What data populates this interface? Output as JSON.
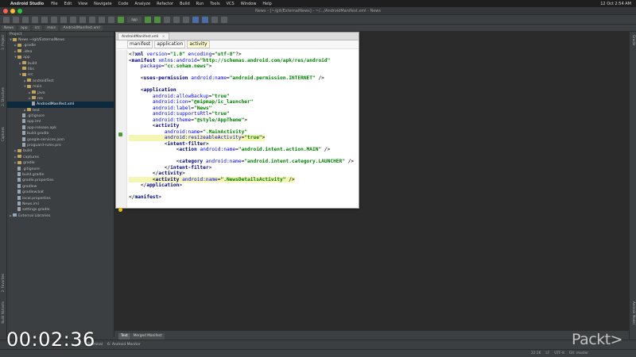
{
  "menubar": {
    "app_name": "Android Studio",
    "items": [
      "File",
      "Edit",
      "View",
      "Navigate",
      "Code",
      "Analyze",
      "Refactor",
      "Build",
      "Run",
      "Tools",
      "VCS",
      "Window",
      "Help"
    ],
    "clock": "12 Oct  2:54 AM"
  },
  "window_title": "News - [~/git/ExternalNews] - ~/.../AndroidManifest.xml - News",
  "toolbar": {
    "run_config": "app"
  },
  "breadcrumb": [
    "News",
    "app",
    "src",
    "main",
    "AndroidManifest.xml"
  ],
  "project_panel": {
    "header": "Project",
    "tree": [
      {
        "label": "News ~/git/ExternalNews",
        "indent": 0,
        "kind": "folder",
        "arrow": "▼"
      },
      {
        "label": ".gradle",
        "indent": 1,
        "kind": "folder",
        "arrow": "▶"
      },
      {
        "label": ".idea",
        "indent": 1,
        "kind": "folder",
        "arrow": "▶"
      },
      {
        "label": "app",
        "indent": 1,
        "kind": "folder",
        "arrow": "▼"
      },
      {
        "label": "build",
        "indent": 2,
        "kind": "folder",
        "arrow": "▶"
      },
      {
        "label": "libs",
        "indent": 2,
        "kind": "folder",
        "arrow": ""
      },
      {
        "label": "src",
        "indent": 2,
        "kind": "folder",
        "arrow": "▼"
      },
      {
        "label": "androidTest",
        "indent": 3,
        "kind": "folder",
        "arrow": "▶"
      },
      {
        "label": "main",
        "indent": 3,
        "kind": "folder",
        "arrow": "▼"
      },
      {
        "label": "java",
        "indent": 4,
        "kind": "folder",
        "arrow": "▶"
      },
      {
        "label": "res",
        "indent": 4,
        "kind": "folder",
        "arrow": "▶"
      },
      {
        "label": "AndroidManifest.xml",
        "indent": 4,
        "kind": "file",
        "arrow": "",
        "selected": true
      },
      {
        "label": "test",
        "indent": 3,
        "kind": "folder",
        "arrow": "▶"
      },
      {
        "label": ".gitignore",
        "indent": 2,
        "kind": "file",
        "arrow": ""
      },
      {
        "label": "app.iml",
        "indent": 2,
        "kind": "file",
        "arrow": ""
      },
      {
        "label": "app-release.apk",
        "indent": 2,
        "kind": "file",
        "arrow": ""
      },
      {
        "label": "build.gradle",
        "indent": 2,
        "kind": "file",
        "arrow": ""
      },
      {
        "label": "google-services.json",
        "indent": 2,
        "kind": "file",
        "arrow": ""
      },
      {
        "label": "proguard-rules.pro",
        "indent": 2,
        "kind": "file",
        "arrow": ""
      },
      {
        "label": "build",
        "indent": 1,
        "kind": "folder",
        "arrow": "▶"
      },
      {
        "label": "captures",
        "indent": 1,
        "kind": "folder",
        "arrow": "▶"
      },
      {
        "label": "gradle",
        "indent": 1,
        "kind": "folder",
        "arrow": "▶"
      },
      {
        "label": ".gitignore",
        "indent": 1,
        "kind": "file",
        "arrow": ""
      },
      {
        "label": "build.gradle",
        "indent": 1,
        "kind": "file",
        "arrow": ""
      },
      {
        "label": "gradle.properties",
        "indent": 1,
        "kind": "file",
        "arrow": ""
      },
      {
        "label": "gradlew",
        "indent": 1,
        "kind": "file",
        "arrow": ""
      },
      {
        "label": "gradlew.bat",
        "indent": 1,
        "kind": "file",
        "arrow": ""
      },
      {
        "label": "local.properties",
        "indent": 1,
        "kind": "file",
        "arrow": ""
      },
      {
        "label": "News.iml",
        "indent": 1,
        "kind": "file",
        "arrow": ""
      },
      {
        "label": "settings.gradle",
        "indent": 1,
        "kind": "file",
        "arrow": ""
      },
      {
        "label": "External Libraries",
        "indent": 0,
        "kind": "plain",
        "arrow": "▶"
      }
    ]
  },
  "side_tabs": {
    "left": [
      "1: Project",
      "2: Structure",
      "Captures",
      "2: Favorites",
      "Build Variants"
    ],
    "right": [
      "Gradle",
      "Android Model"
    ]
  },
  "editor": {
    "tab_label": "AndroidManifest.xml",
    "crumbs": [
      "manifest",
      "application",
      "activity"
    ],
    "lines": [
      {
        "segs": [
          [
            "pi",
            "<?"
          ],
          [
            "tag",
            "xml "
          ],
          [
            "attr",
            "version"
          ],
          [
            "pi",
            "="
          ],
          [
            "aval",
            "\"1.0\""
          ],
          [
            "attr",
            " encoding"
          ],
          [
            "pi",
            "="
          ],
          [
            "aval",
            "\"utf-8\""
          ],
          [
            "pi",
            "?>"
          ]
        ]
      },
      {
        "segs": [
          [
            "pi",
            "<"
          ],
          [
            "tag",
            "manifest "
          ],
          [
            "attr",
            "xmlns:android"
          ],
          [
            "pi",
            "="
          ],
          [
            "aval",
            "\"http://schemas.android.com/apk/res/android\""
          ]
        ]
      },
      {
        "segs": [
          [
            "pi",
            "    "
          ],
          [
            "attr",
            "package"
          ],
          [
            "pi",
            "="
          ],
          [
            "aval",
            "\"cc.soham.news\""
          ],
          [
            "pi",
            ">"
          ]
        ]
      },
      {
        "segs": []
      },
      {
        "segs": [
          [
            "pi",
            "    <"
          ],
          [
            "tag",
            "uses-permission "
          ],
          [
            "attr",
            "android:name"
          ],
          [
            "pi",
            "="
          ],
          [
            "aval",
            "\"android.permission.INTERNET\""
          ],
          [
            "pi",
            " />"
          ]
        ]
      },
      {
        "segs": []
      },
      {
        "segs": [
          [
            "pi",
            "    <"
          ],
          [
            "tag",
            "application"
          ]
        ]
      },
      {
        "segs": [
          [
            "pi",
            "        "
          ],
          [
            "attr",
            "android:allowBackup"
          ],
          [
            "pi",
            "="
          ],
          [
            "aval",
            "\"true\""
          ]
        ]
      },
      {
        "segs": [
          [
            "pi",
            "        "
          ],
          [
            "attr",
            "android:icon"
          ],
          [
            "pi",
            "="
          ],
          [
            "aval",
            "\"@mipmap/ic_launcher\""
          ]
        ]
      },
      {
        "segs": [
          [
            "pi",
            "        "
          ],
          [
            "attr",
            "android:label"
          ],
          [
            "pi",
            "="
          ],
          [
            "aval",
            "\"News\""
          ]
        ]
      },
      {
        "segs": [
          [
            "pi",
            "        "
          ],
          [
            "attr",
            "android:supportsRtl"
          ],
          [
            "pi",
            "="
          ],
          [
            "aval",
            "\"true\""
          ]
        ]
      },
      {
        "segs": [
          [
            "pi",
            "        "
          ],
          [
            "attr",
            "android:theme"
          ],
          [
            "pi",
            "="
          ],
          [
            "aval",
            "\"@style/AppTheme\""
          ],
          [
            "pi",
            ">"
          ]
        ]
      },
      {
        "segs": [
          [
            "pi",
            "        <"
          ],
          [
            "tag",
            "activity"
          ]
        ]
      },
      {
        "segs": [
          [
            "pi",
            "            "
          ],
          [
            "attr",
            "android:name"
          ],
          [
            "pi",
            "="
          ],
          [
            "aval",
            "\".MainActivity\""
          ]
        ]
      },
      {
        "segs": [
          [
            "pi",
            "            "
          ],
          [
            "attr",
            "android:resizeableActivity"
          ],
          [
            "pi",
            "="
          ],
          [
            "aval",
            "\"true\""
          ],
          [
            "pi",
            ">"
          ]
        ],
        "hl": true
      },
      {
        "segs": [
          [
            "pi",
            "            <"
          ],
          [
            "tag",
            "intent-filter"
          ],
          [
            "pi",
            ">"
          ]
        ]
      },
      {
        "segs": [
          [
            "pi",
            "                <"
          ],
          [
            "tag",
            "action "
          ],
          [
            "attr",
            "android:name"
          ],
          [
            "pi",
            "="
          ],
          [
            "aval",
            "\"android.intent.action.MAIN\""
          ],
          [
            "pi",
            " />"
          ]
        ]
      },
      {
        "segs": []
      },
      {
        "segs": [
          [
            "pi",
            "                <"
          ],
          [
            "tag",
            "category "
          ],
          [
            "attr",
            "android:name"
          ],
          [
            "pi",
            "="
          ],
          [
            "aval",
            "\"android.intent.category.LAUNCHER\""
          ],
          [
            "pi",
            " />"
          ]
        ]
      },
      {
        "segs": [
          [
            "pi",
            "            </"
          ],
          [
            "tag",
            "intent-filter"
          ],
          [
            "pi",
            ">"
          ]
        ]
      },
      {
        "segs": [
          [
            "pi",
            "        </"
          ],
          [
            "tag",
            "activity"
          ],
          [
            "pi",
            ">"
          ]
        ]
      },
      {
        "segs": [
          [
            "pi",
            "        <"
          ],
          [
            "tag",
            "activity "
          ],
          [
            "attr",
            "android:name"
          ],
          [
            "pi",
            "="
          ],
          [
            "aval",
            "\".NewsDetailsActivity\""
          ],
          [
            "pi",
            " />"
          ]
        ],
        "hl": true
      },
      {
        "segs": [
          [
            "pi",
            "    </"
          ],
          [
            "tag",
            "application"
          ],
          [
            "pi",
            ">"
          ]
        ]
      },
      {
        "segs": []
      },
      {
        "segs": [
          [
            "pi",
            "</"
          ],
          [
            "tag",
            "manifest"
          ],
          [
            "pi",
            ">"
          ]
        ]
      }
    ]
  },
  "bottom_tabs": [
    "Text",
    "Merged Manifest"
  ],
  "bottom_toolbar": [
    "Terminal",
    "6: Android Monitor"
  ],
  "status": {
    "position": "22:16",
    "line_sep": "LF",
    "encoding": "UTF-8",
    "vcs": "Git: master"
  },
  "overlay": {
    "timer": "00:02:36",
    "logo_text": "Packt>"
  },
  "colors": {
    "ide_bg": "#3c3f41",
    "editor_bg": "#ffffff",
    "selection": "#0d293e",
    "tag": "#000080",
    "attr": "#0000ff",
    "value": "#008000"
  }
}
